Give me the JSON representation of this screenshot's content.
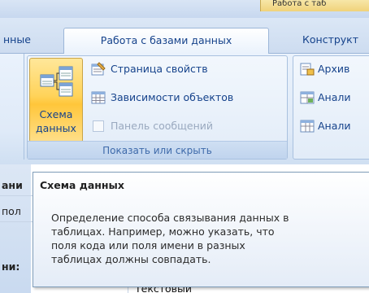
{
  "context_tab_header": "Работа с таб",
  "tabs": [
    {
      "label": "нные"
    },
    {
      "label": "Работа с базами данных"
    },
    {
      "label": "Конструкт"
    }
  ],
  "ribbon": {
    "show_hide_group": {
      "big_button_label_line1": "Схема",
      "big_button_label_line2": "данных",
      "small_buttons": [
        {
          "label": "Страница свойств",
          "icon": "property-sheet-icon"
        },
        {
          "label": "Зависимости объектов",
          "icon": "object-dependencies-icon"
        },
        {
          "label": "Панель сообщений",
          "icon": "checkbox",
          "enabled": false
        }
      ],
      "footer": "Показать или скрыть"
    },
    "right_group": {
      "buttons": [
        {
          "label": "Архив",
          "icon": "archive-icon"
        },
        {
          "label": "Анали",
          "icon": "analyze-icon"
        },
        {
          "label": "Анали",
          "icon": "analyze-table-icon"
        }
      ]
    }
  },
  "background": {
    "row_texts": [
      "ани",
      "пол",
      "ни:"
    ],
    "cell_text": "Текстовый"
  },
  "tooltip": {
    "title": "Схема данных",
    "body": "Определение способа связывания данных в\nтаблицах. Например, можно указать, что\nполя кода или поля имени в разных\nтаблицах должны совпадать."
  },
  "colors": {
    "ribbon_text": "#15428b",
    "highlight": "#ffd35a",
    "tooltip_border": "#7f9db9"
  }
}
